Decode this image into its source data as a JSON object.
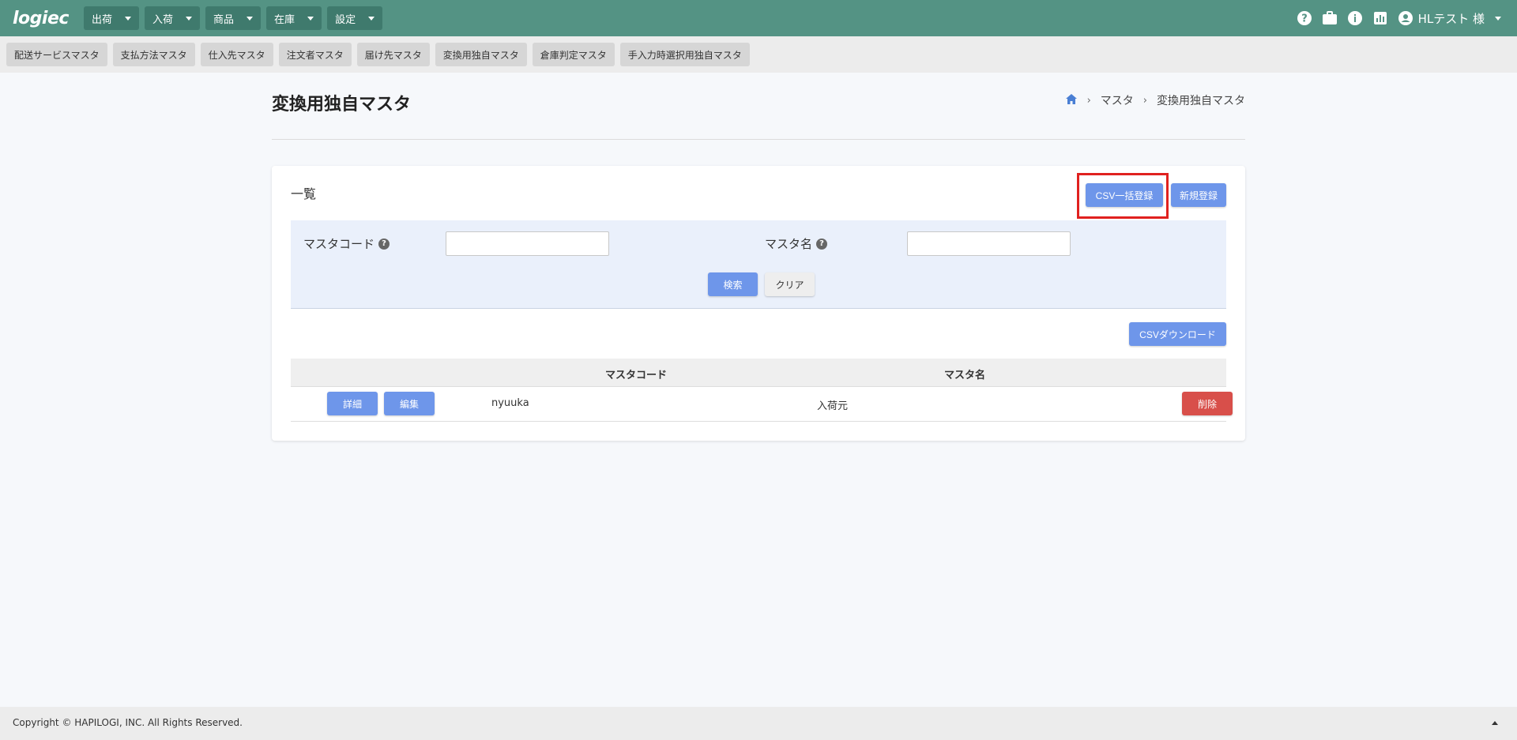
{
  "header": {
    "logo_text": "logiec",
    "menus": [
      {
        "label": "出荷"
      },
      {
        "label": "入荷"
      },
      {
        "label": "商品"
      },
      {
        "label": "在庫"
      },
      {
        "label": "設定"
      }
    ],
    "user_label": "HLテスト 様"
  },
  "subnav": {
    "items": [
      {
        "label": "配送サービスマスタ"
      },
      {
        "label": "支払方法マスタ"
      },
      {
        "label": "仕入先マスタ"
      },
      {
        "label": "注文者マスタ"
      },
      {
        "label": "届け先マスタ"
      },
      {
        "label": "変換用独自マスタ"
      },
      {
        "label": "倉庫判定マスタ"
      },
      {
        "label": "手入力時選択用独自マスタ"
      }
    ]
  },
  "page": {
    "title": "変換用独自マスタ",
    "breadcrumb": [
      "マスタ",
      "変換用独自マスタ"
    ]
  },
  "list": {
    "title": "一覧",
    "csv_bulk_button": "CSV一括登録",
    "new_button": "新規登録",
    "search": {
      "code_label": "マスタコード",
      "name_label": "マスタ名",
      "code_value": "",
      "name_value": "",
      "search_button": "検索",
      "clear_button": "クリア"
    },
    "csv_download_button": "CSVダウンロード",
    "columns": [
      "マスタコード",
      "マスタ名"
    ],
    "rows": [
      {
        "detail": "詳細",
        "edit": "編集",
        "code": "nyuuka",
        "name": "入荷元",
        "delete": "削除"
      }
    ]
  },
  "footer": {
    "copyright": "Copyright © HAPILOGI, INC. All Rights Reserved."
  },
  "colors": {
    "header": "#549384",
    "primary": "#6e96ea",
    "danger": "#d84f4a",
    "highlight": "#e0211f"
  }
}
